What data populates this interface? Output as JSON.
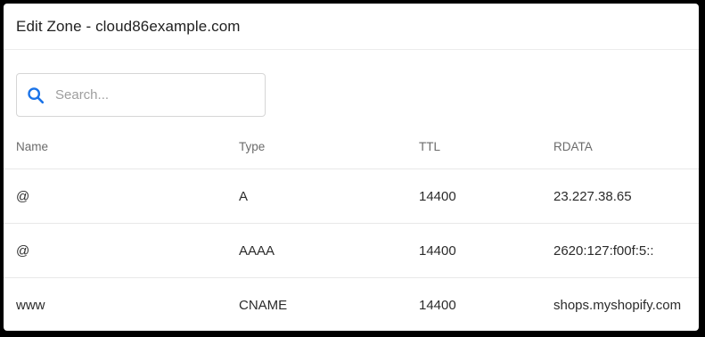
{
  "header": {
    "title": "Edit Zone - cloud86example.com"
  },
  "search": {
    "placeholder": "Search...",
    "value": "",
    "icon": "search-icon"
  },
  "table": {
    "columns": {
      "name": "Name",
      "type": "Type",
      "ttl": "TTL",
      "rdata": "RDATA"
    },
    "rows": [
      {
        "name": "@",
        "type": "A",
        "ttl": "14400",
        "rdata": "23.227.38.65"
      },
      {
        "name": "@",
        "type": "AAAA",
        "ttl": "14400",
        "rdata": "2620:127:f00f:5::"
      },
      {
        "name": "www",
        "type": "CNAME",
        "ttl": "14400",
        "rdata": "shops.myshopify.com"
      }
    ]
  },
  "colors": {
    "accent": "#1a73e8",
    "frame_background": "#000000"
  }
}
